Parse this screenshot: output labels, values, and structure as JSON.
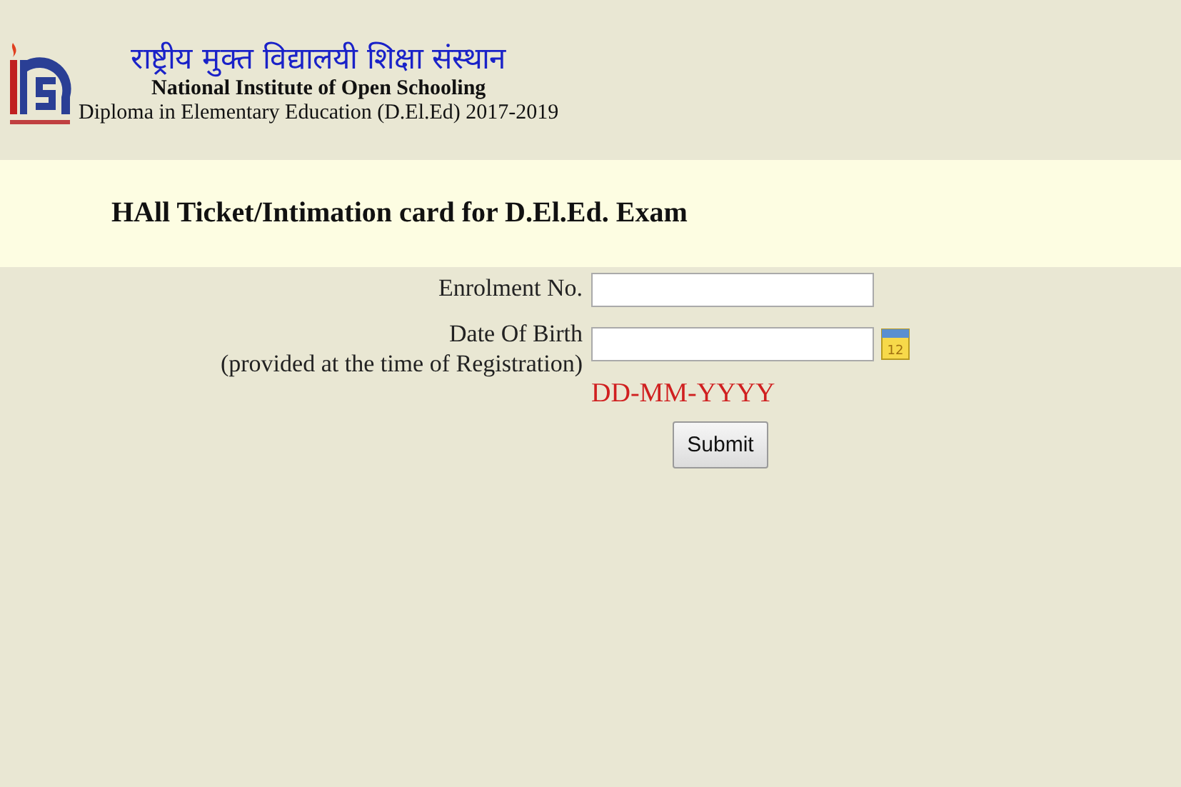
{
  "header": {
    "hindi_title": "राष्ट्रीय मुक्त विद्यालयी शिक्षा संस्थान",
    "institute": "National Institute of Open Schooling",
    "program": "Diploma in Elementary Education (D.El.Ed) 2017-2019"
  },
  "banner": {
    "title": "HAll Ticket/Intimation card for D.El.Ed. Exam"
  },
  "form": {
    "fields": [
      {
        "kind": "text",
        "label": "Enrolment No."
      },
      {
        "kind": "date",
        "label": "Date Of Birth",
        "sublabel": "(provided at the time of Registration)",
        "calendar_day": "12",
        "format_hint": "DD-MM-YYYY"
      }
    ],
    "submit": "Submit"
  }
}
